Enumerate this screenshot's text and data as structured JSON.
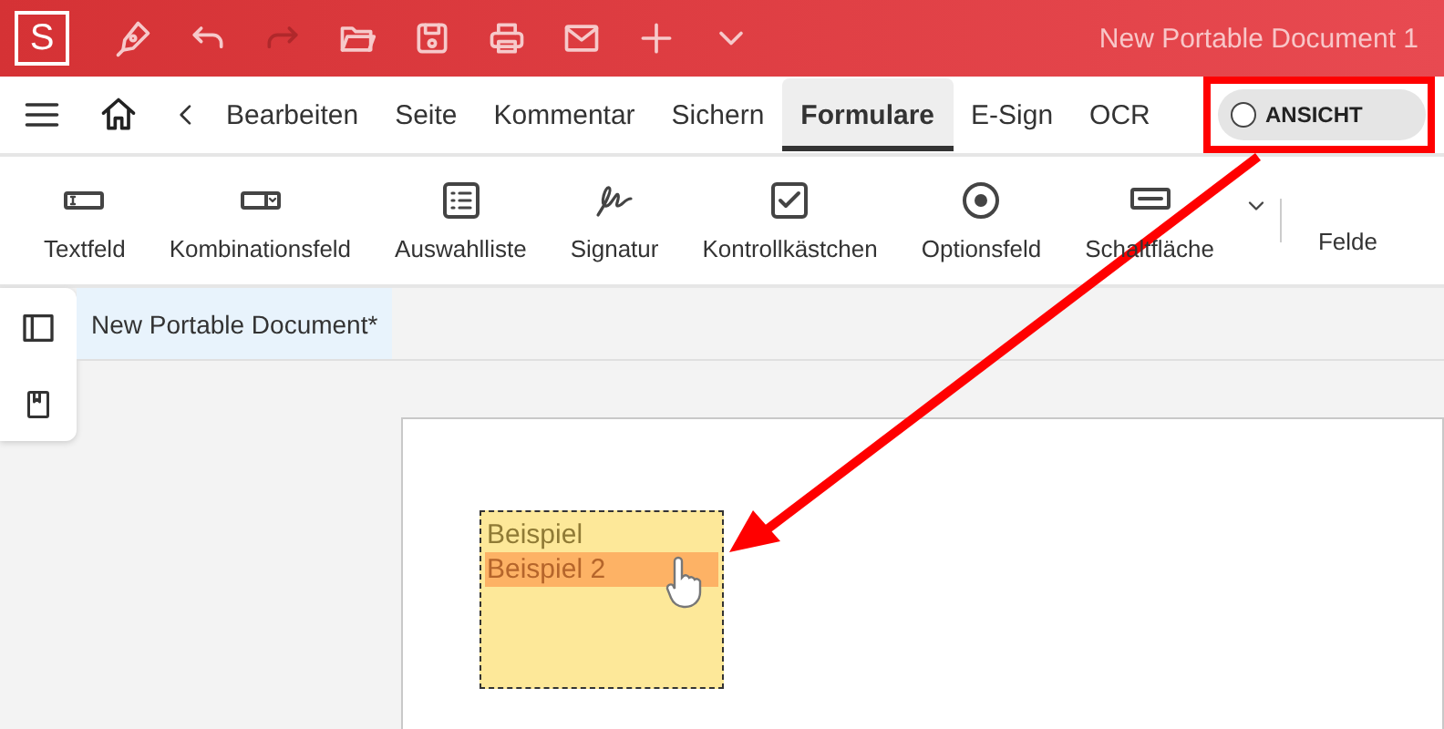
{
  "title_bar": {
    "logo": "S",
    "document_title": "New Portable Document 1"
  },
  "quick_actions": [
    {
      "kind": "pen",
      "disabled": false
    },
    {
      "kind": "undo",
      "disabled": false
    },
    {
      "kind": "redo",
      "disabled": true
    },
    {
      "kind": "folder",
      "disabled": false
    },
    {
      "kind": "save",
      "disabled": false
    },
    {
      "kind": "print",
      "disabled": false
    },
    {
      "kind": "mail",
      "disabled": false
    },
    {
      "kind": "plus",
      "disabled": false
    },
    {
      "kind": "chevron",
      "disabled": false
    }
  ],
  "menu_tabs": [
    {
      "label": "Bearbeiten",
      "selected": false
    },
    {
      "label": "Seite",
      "selected": false
    },
    {
      "label": "Kommentar",
      "selected": false
    },
    {
      "label": "Sichern",
      "selected": false
    },
    {
      "label": "Formulare",
      "selected": true
    },
    {
      "label": "E-Sign",
      "selected": false
    },
    {
      "label": "OCR",
      "selected": false
    }
  ],
  "view_toggle": {
    "label": "ANSICHT",
    "on": false
  },
  "ribbon": [
    {
      "label": "Textfeld",
      "kind": "textfield"
    },
    {
      "label": "Kombinationsfeld",
      "kind": "combobox"
    },
    {
      "label": "Auswahlliste",
      "kind": "listbox"
    },
    {
      "label": "Signatur",
      "kind": "signature"
    },
    {
      "label": "Kontrollkästchen",
      "kind": "checkbox"
    },
    {
      "label": "Optionsfeld",
      "kind": "radio"
    },
    {
      "label": "Schaltfläche",
      "kind": "button"
    },
    {
      "label": "Felde",
      "kind": "fields"
    }
  ],
  "document_tab": {
    "label": "New Portable Document*"
  },
  "listbox": {
    "items": [
      {
        "label": "Beispiel",
        "selected": false
      },
      {
        "label": "Beispiel 2",
        "selected": true
      }
    ]
  }
}
